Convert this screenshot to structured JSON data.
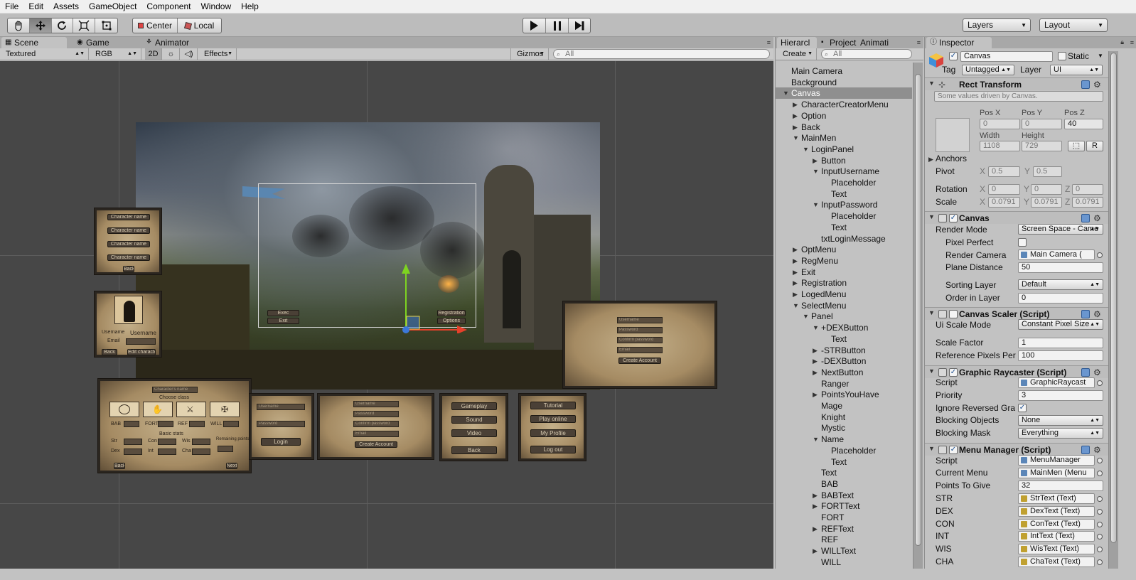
{
  "menubar": {
    "items": [
      "File",
      "Edit",
      "Assets",
      "GameObject",
      "Component",
      "Window",
      "Help"
    ]
  },
  "toolbar": {
    "tools": [
      "hand-icon",
      "move-icon",
      "rotate-icon",
      "scale-icon",
      "rect-tool-icon"
    ],
    "pivot_label": "Center",
    "space_label": "Local",
    "layers_label": "Layers",
    "layout_label": "Layout"
  },
  "scene": {
    "tabs": [
      "Scene",
      "Game",
      "Animator"
    ],
    "render_mode": "Textured",
    "color_mode": "RGB",
    "mode_2d": "2D",
    "effects": "Effects",
    "gizmos": "Gizmos",
    "search_placeholder": "All",
    "cards": {
      "char_name_list": [
        "Character name",
        "Character name",
        "Character name",
        "Character name"
      ],
      "char_list_footer": "Back",
      "profile_name_label": "Username",
      "profile_name_value": "Username",
      "profile_email": "Email",
      "profile_back": "Back",
      "profile_select": "Edit character",
      "left_mini_buttons": [
        "Exec",
        "Exit"
      ],
      "right_mini_buttons": [
        "Registration",
        "Options"
      ],
      "registration_fields": [
        "Username",
        "Password",
        "Confirm password",
        "Email"
      ],
      "registration_button": "Create Account",
      "creator_name": "Character's name",
      "creator_class": "Choose class",
      "creator_stats": [
        "BAB",
        "FORT",
        "REF",
        "WILL"
      ],
      "creator_basic_stats": "Basic stats",
      "creator_attrs": [
        "Str",
        "Dex",
        "Con",
        "Int",
        "Wis",
        "Cha"
      ],
      "creator_remaining": "Remaining points",
      "creator_back": "Back",
      "creator_next": "Next",
      "login_fields": [
        "Username",
        "Password"
      ],
      "login_button": "Login",
      "reg2_fields": [
        "Username",
        "Password",
        "Confirm password",
        "Email"
      ],
      "reg2_button": "Create Account",
      "options_buttons": [
        "Gameplay",
        "Sound",
        "Video",
        "Back"
      ],
      "logged_buttons": [
        "Tutorial",
        "Play online",
        "My Profile",
        "Log out"
      ]
    }
  },
  "hierarchy": {
    "tabs": [
      "Hierarcl",
      "Project",
      "Animati"
    ],
    "create_label": "Create",
    "search_placeholder": "All",
    "rows": [
      {
        "label": "Main Camera",
        "depth": 0,
        "fold": ""
      },
      {
        "label": "Background",
        "depth": 0,
        "fold": ""
      },
      {
        "label": "Canvas",
        "depth": 0,
        "fold": "open",
        "selected": true
      },
      {
        "label": "CharacterCreatorMenu",
        "depth": 1,
        "fold": "closed"
      },
      {
        "label": "Option",
        "depth": 1,
        "fold": "closed"
      },
      {
        "label": "Back",
        "depth": 1,
        "fold": "closed"
      },
      {
        "label": "MainMen",
        "depth": 1,
        "fold": "open"
      },
      {
        "label": "LoginPanel",
        "depth": 2,
        "fold": "open"
      },
      {
        "label": "Button",
        "depth": 3,
        "fold": "closed"
      },
      {
        "label": "InputUsername",
        "depth": 3,
        "fold": "open"
      },
      {
        "label": "Placeholder",
        "depth": 4,
        "fold": ""
      },
      {
        "label": "Text",
        "depth": 4,
        "fold": ""
      },
      {
        "label": "InputPassword",
        "depth": 3,
        "fold": "open"
      },
      {
        "label": "Placeholder",
        "depth": 4,
        "fold": ""
      },
      {
        "label": "Text",
        "depth": 4,
        "fold": ""
      },
      {
        "label": "txtLoginMessage",
        "depth": 3,
        "fold": ""
      },
      {
        "label": "OptMenu",
        "depth": 1,
        "fold": "closed"
      },
      {
        "label": "RegMenu",
        "depth": 1,
        "fold": "closed"
      },
      {
        "label": "Exit",
        "depth": 1,
        "fold": "closed"
      },
      {
        "label": "Registration",
        "depth": 1,
        "fold": "closed"
      },
      {
        "label": "LogedMenu",
        "depth": 1,
        "fold": "closed"
      },
      {
        "label": "SelectMenu",
        "depth": 1,
        "fold": "open"
      },
      {
        "label": "Panel",
        "depth": 2,
        "fold": "open"
      },
      {
        "label": "+DEXButton",
        "depth": 3,
        "fold": "open"
      },
      {
        "label": "Text",
        "depth": 4,
        "fold": ""
      },
      {
        "label": "-STRButton",
        "depth": 3,
        "fold": "closed"
      },
      {
        "label": "-DEXButton",
        "depth": 3,
        "fold": "closed"
      },
      {
        "label": "NextButton",
        "depth": 3,
        "fold": "closed"
      },
      {
        "label": "Ranger",
        "depth": 3,
        "fold": ""
      },
      {
        "label": "PointsYouHave",
        "depth": 3,
        "fold": "closed"
      },
      {
        "label": "Mage",
        "depth": 3,
        "fold": ""
      },
      {
        "label": "Knight",
        "depth": 3,
        "fold": ""
      },
      {
        "label": "Mystic",
        "depth": 3,
        "fold": ""
      },
      {
        "label": "Name",
        "depth": 3,
        "fold": "open"
      },
      {
        "label": "Placeholder",
        "depth": 4,
        "fold": ""
      },
      {
        "label": "Text",
        "depth": 4,
        "fold": ""
      },
      {
        "label": "Text",
        "depth": 3,
        "fold": ""
      },
      {
        "label": "BAB",
        "depth": 3,
        "fold": ""
      },
      {
        "label": "BABText",
        "depth": 3,
        "fold": "closed"
      },
      {
        "label": "FORTText",
        "depth": 3,
        "fold": "closed"
      },
      {
        "label": "FORT",
        "depth": 3,
        "fold": ""
      },
      {
        "label": "REFText",
        "depth": 3,
        "fold": "closed"
      },
      {
        "label": "REF",
        "depth": 3,
        "fold": ""
      },
      {
        "label": "WILLText",
        "depth": 3,
        "fold": "closed"
      },
      {
        "label": "WILL",
        "depth": 3,
        "fold": ""
      }
    ]
  },
  "inspector": {
    "tab": "Inspector",
    "object_name": "Canvas",
    "static_label": "Static",
    "tag_label": "Tag",
    "tag_value": "Untagged",
    "layer_label": "Layer",
    "layer_value": "UI",
    "rect": {
      "title": "Rect Transform",
      "note": "Some values driven by Canvas.",
      "pos_x_label": "Pos X",
      "pos_y_label": "Pos Y",
      "pos_z_label": "Pos Z",
      "pos_x": "0",
      "pos_y": "0",
      "pos_z": "40",
      "width_label": "Width",
      "height_label": "Height",
      "width": "1108",
      "height": "729",
      "r_label": "R",
      "anchors_label": "Anchors",
      "pivot_label": "Pivot",
      "pivot_x": "0.5",
      "pivot_y": "0.5",
      "rotation_label": "Rotation",
      "rot_x": "0",
      "rot_y": "0",
      "rot_z": "0",
      "scale_label": "Scale",
      "scale_x": "0.0791",
      "scale_y": "0.0791",
      "scale_z": "0.0791",
      "x": "X",
      "y": "Y",
      "z": "Z"
    },
    "canvas": {
      "title": "Canvas",
      "render_mode_label": "Render Mode",
      "render_mode": "Screen Space - Came",
      "pixel_perfect_label": "Pixel Perfect",
      "render_camera_label": "Render Camera",
      "render_camera": "Main Camera (",
      "plane_distance_label": "Plane Distance",
      "plane_distance": "50",
      "sorting_layer_label": "Sorting Layer",
      "sorting_layer": "Default",
      "order_label": "Order in Layer",
      "order": "0"
    },
    "scaler": {
      "title": "Canvas Scaler (Script)",
      "mode_label": "Ui Scale Mode",
      "mode": "Constant Pixel Size",
      "factor_label": "Scale Factor",
      "factor": "1",
      "ref_label": "Reference Pixels Per",
      "ref": "100"
    },
    "raycaster": {
      "title": "Graphic Raycaster (Script)",
      "script_label": "Script",
      "script": "GraphicRaycast",
      "priority_label": "Priority",
      "priority": "3",
      "ignore_label": "Ignore Reversed Gra",
      "blocking_label": "Blocking Objects",
      "blocking": "None",
      "mask_label": "Blocking Mask",
      "mask": "Everything"
    },
    "menu_manager": {
      "title": "Menu Manager (Script)",
      "script_label": "Script",
      "script": "MenuManager",
      "current_label": "Current Menu",
      "current": "MainMen (Menu",
      "points_label": "Points To Give",
      "points": "32",
      "refs": [
        {
          "label": "STR",
          "value": "StrText (Text)"
        },
        {
          "label": "DEX",
          "value": "DexText (Text)"
        },
        {
          "label": "CON",
          "value": "ConText (Text)"
        },
        {
          "label": "INT",
          "value": "IntText (Text)"
        },
        {
          "label": "WIS",
          "value": "WisText (Text)"
        },
        {
          "label": "CHA",
          "value": "ChaText (Text)"
        }
      ]
    }
  },
  "colors": {
    "selection": "#8f8f8f",
    "viewport": "#474747",
    "panel": "#c2c2c2",
    "gizmo_y": "#7ed321",
    "gizmo_x": "#e5402a",
    "gizmo_center": "#3c78d8"
  }
}
